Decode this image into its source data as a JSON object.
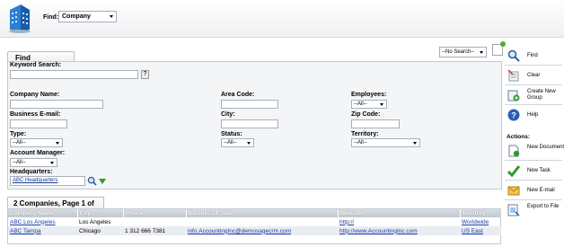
{
  "header": {
    "find_label": "Find:",
    "find_selected": "Company"
  },
  "find_panel": {
    "tab_label": "Find",
    "saved_search_selected": "--No Search--",
    "keyword_label": "Keyword Search:",
    "help_button": "?",
    "company_name_label": "Company Name:",
    "area_code_label": "Area Code:",
    "employees_label": "Employees:",
    "employees_selected": "--All--",
    "business_email_label": "Business E-mail:",
    "city_label": "City:",
    "zip_label": "Zip Code:",
    "type_label": "Type:",
    "type_selected": "--All--",
    "status_label": "Status:",
    "status_selected": "--All--",
    "territory_label": "Territory:",
    "territory_selected": "--All--",
    "account_manager_label": "Account Manager:",
    "account_manager_selected": "--All--",
    "headquarters_label": "Headquarters:",
    "headquarters_value": "ABC Headquarters"
  },
  "results": {
    "tab_label": "2 Companies, Page 1 of 1",
    "columns": [
      "Company Name",
      "City",
      "Phone",
      "Business E-mail",
      "Website",
      "Territory"
    ],
    "rows": [
      [
        "ABC Los Angeles",
        "Los Angeles",
        "",
        "",
        "http://",
        "Worldwide"
      ],
      [
        "ABC Tampa",
        "Chicago",
        "1 312 666 7381",
        "info.AccountingInc@demosagecrm.com",
        "http://www.AccountingInc.com",
        "US East"
      ]
    ]
  },
  "sidebar": {
    "find": "Find",
    "clear": "Clear",
    "create_group": "Create New Group",
    "help": "Help",
    "actions_label": "Actions:",
    "new_document": "New Document",
    "new_task": "New Task",
    "new_email": "New E-mail",
    "export": "Export to File"
  },
  "colors": {
    "header_bg": "#eef0f2",
    "link": "#1a3caa",
    "table_header": "#c1c8d0",
    "accent_green": "#2e9a2e"
  },
  "icons": [
    "building-logo-icon",
    "magnifier-icon",
    "clear-icon",
    "create-group-icon",
    "help-icon",
    "new-document-icon",
    "new-task-icon",
    "new-email-icon",
    "export-icon"
  ]
}
